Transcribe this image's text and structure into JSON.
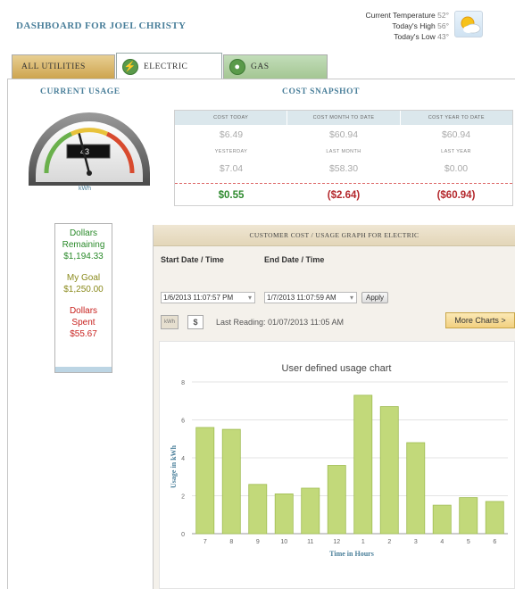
{
  "header": {
    "title": "DASHBOARD FOR JOEL CHRISTY",
    "weather": {
      "temp_label": "Current Temperature",
      "temp_value": "52°",
      "high_label": "Today's High",
      "high_value": "56°",
      "low_label": "Today's Low",
      "low_value": "43°",
      "icon": "partly-sunny-icon"
    }
  },
  "tabs": [
    {
      "label": "ALL UTILITIES"
    },
    {
      "label": "ELECTRIC",
      "icon": "lightning-icon",
      "active": true
    },
    {
      "label": "GAS",
      "icon": "flame-icon"
    }
  ],
  "current_usage": {
    "title": "CURRENT USAGE",
    "value": "43",
    "unit": "kWh",
    "needle_fraction": 0.42
  },
  "cost_snapshot": {
    "title": "COST SNAPSHOT",
    "headers": [
      "COST TODAY",
      "COST MONTH TO DATE",
      "COST YEAR TO DATE"
    ],
    "current": [
      "$6.49",
      "$60.94",
      "$60.94"
    ],
    "sub_labels": [
      "YESTERDAY",
      "LAST MONTH",
      "LAST YEAR"
    ],
    "previous": [
      "$7.04",
      "$58.30",
      "$0.00"
    ],
    "diff": [
      "$0.55",
      "($2.64)",
      "($60.94)"
    ]
  },
  "budget": {
    "remaining_label": "Dollars Remaining",
    "remaining_line1": "Dollars",
    "remaining_line2": "Remaining",
    "remaining_value": "$1,194.33",
    "goal_label": "My Goal",
    "goal_value": "$1,250.00",
    "spent_line1": "Dollars",
    "spent_line2": "Spent",
    "spent_value": "$55.67"
  },
  "graph_panel": {
    "title": "CUSTOMER COST / USAGE GRAPH FOR ELECTRIC",
    "start_label": "Start Date / Time",
    "start_value": "1/6/2013 11:07:57 PM",
    "end_label": "End Date / Time",
    "end_value": "1/7/2013 11:07:59 AM",
    "apply_label": "Apply",
    "kwh_label": "kWh",
    "dollar_label": "$",
    "last_reading": "Last Reading: 01/07/2013 11:05 AM",
    "more_charts_label": "More Charts >"
  },
  "colors": {
    "bar_fill": "#c2d97a",
    "bar_stroke": "#9fbc52",
    "title_blue": "#4a7f9a",
    "positive": "#2e8a2e",
    "negative": "#b4282c"
  },
  "chart_data": {
    "type": "bar",
    "title": "User defined usage chart",
    "xlabel": "Time in Hours",
    "ylabel": "Usage in kWh",
    "categories": [
      "7",
      "8",
      "9",
      "10",
      "11",
      "12",
      "1",
      "2",
      "3",
      "4",
      "5",
      "6"
    ],
    "values": [
      5.6,
      5.5,
      2.6,
      2.1,
      2.4,
      3.6,
      7.3,
      6.7,
      4.8,
      1.5,
      1.9,
      1.7
    ],
    "ylim": [
      0,
      8
    ],
    "yticks": [
      0,
      2,
      4,
      6,
      8
    ],
    "grid": true,
    "legend": "none"
  }
}
